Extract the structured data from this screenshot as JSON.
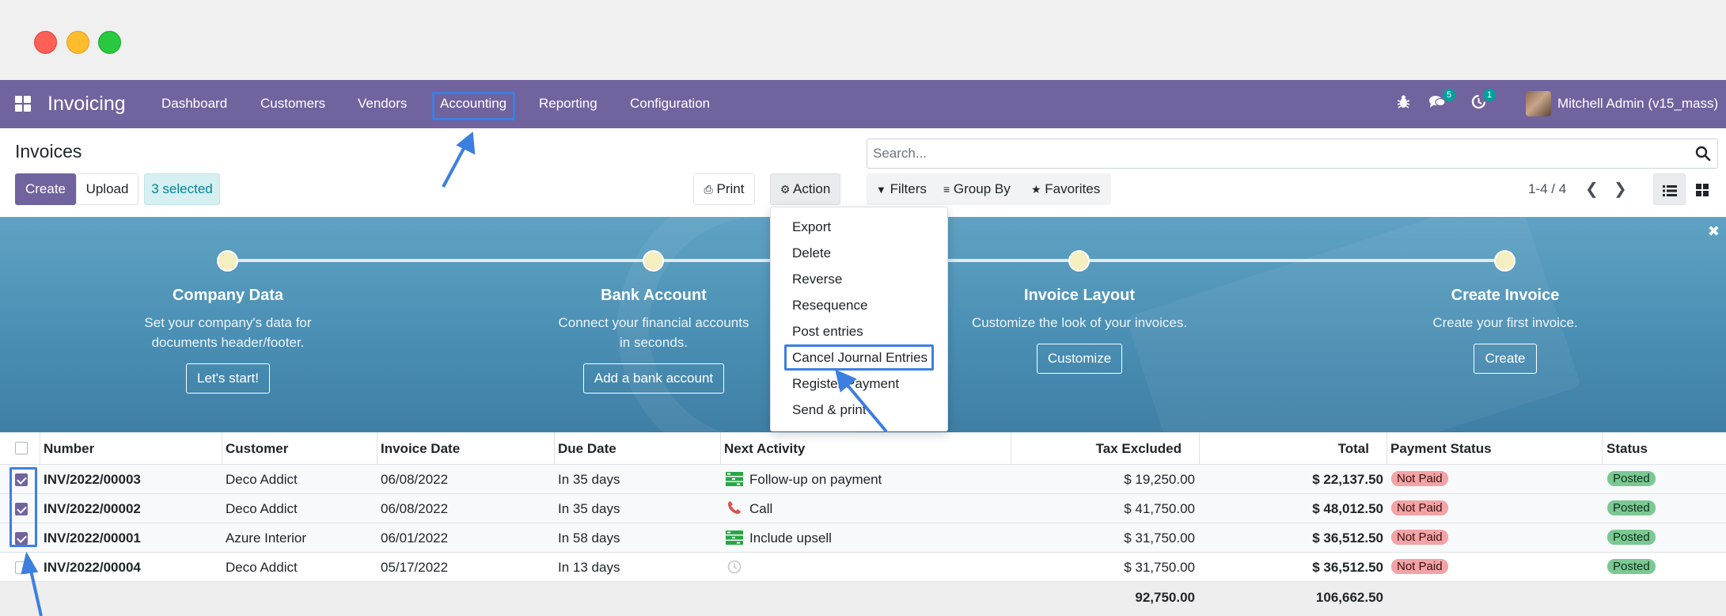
{
  "window": {
    "controls": [
      "close",
      "minimize",
      "zoom"
    ]
  },
  "navbar": {
    "brand": "Invoicing",
    "menu": [
      {
        "label": "Dashboard"
      },
      {
        "label": "Customers"
      },
      {
        "label": "Vendors"
      },
      {
        "label": "Accounting"
      },
      {
        "label": "Reporting"
      },
      {
        "label": "Configuration"
      }
    ],
    "messages_count": "5",
    "activities_count": "1",
    "user_name": "Mitchell Admin (v15_mass)",
    "color": "#71639e"
  },
  "control_panel": {
    "title": "Invoices",
    "create_label": "Create",
    "upload_label": "Upload",
    "selected_label": "3 selected",
    "print_label": "Print",
    "action_label": "Action",
    "search_placeholder": "Search...",
    "filters_label": "Filters",
    "group_by_label": "Group By",
    "favorites_label": "Favorites",
    "pager": "1-4 / 4"
  },
  "action_menu": {
    "items": [
      "Export",
      "Delete",
      "Reverse",
      "Resequence",
      "Post entries",
      "Cancel Journal Entries",
      "Register Payment",
      "Send & print"
    ],
    "highlighted": "Cancel Journal Entries"
  },
  "onboarding": {
    "steps": [
      {
        "title": "Company Data",
        "desc": "Set your company's data for documents header/footer.",
        "button": "Let's start!"
      },
      {
        "title": "Bank Account",
        "desc": "Connect your financial accounts in seconds.",
        "button": "Add a bank account"
      },
      {
        "title": "Invoice Layout",
        "desc": "Customize the look of your invoices.",
        "button": "Customize"
      },
      {
        "title": "Create Invoice",
        "desc": "Create your first invoice.",
        "button": "Create"
      }
    ]
  },
  "table": {
    "columns": [
      "Number",
      "Customer",
      "Invoice Date",
      "Due Date",
      "Next Activity",
      "Tax Excluded",
      "Total",
      "Payment Status",
      "Status"
    ],
    "rows": [
      {
        "selected": true,
        "number": "INV/2022/00003",
        "customer": "Deco Addict",
        "invoice_date": "06/08/2022",
        "due_date": "In 35 days",
        "activity_icon": "tasks-icon",
        "activity": "Follow-up on payment",
        "tax_excluded": "$ 19,250.00",
        "total": "$ 22,137.50",
        "payment_status": "Not Paid",
        "status": "Posted"
      },
      {
        "selected": true,
        "number": "INV/2022/00002",
        "customer": "Deco Addict",
        "invoice_date": "06/08/2022",
        "due_date": "In 35 days",
        "activity_icon": "phone-icon",
        "activity": "Call",
        "tax_excluded": "$ 41,750.00",
        "total": "$ 48,012.50",
        "payment_status": "Not Paid",
        "status": "Posted"
      },
      {
        "selected": true,
        "number": "INV/2022/00001",
        "customer": "Azure Interior",
        "invoice_date": "06/01/2022",
        "due_date": "In 58 days",
        "activity_icon": "tasks-icon",
        "activity": "Include upsell",
        "tax_excluded": "$ 31,750.00",
        "total": "$ 36,512.50",
        "payment_status": "Not Paid",
        "status": "Posted"
      },
      {
        "selected": false,
        "number": "INV/2022/00004",
        "customer": "Deco Addict",
        "invoice_date": "05/17/2022",
        "due_date": "In 13 days",
        "activity_icon": "clock-icon",
        "activity": "",
        "tax_excluded": "$ 31,750.00",
        "total": "$ 36,512.50",
        "payment_status": "Not Paid",
        "status": "Posted"
      }
    ],
    "footer": {
      "tax_excluded": "92,750.00",
      "total": "106,662.50"
    }
  },
  "colors": {
    "accent": "#71639e",
    "annotation": "#3d7fe0",
    "not_paid": "#f2a3a6",
    "posted": "#7bc893",
    "selected_badge": "#d6eff1"
  }
}
